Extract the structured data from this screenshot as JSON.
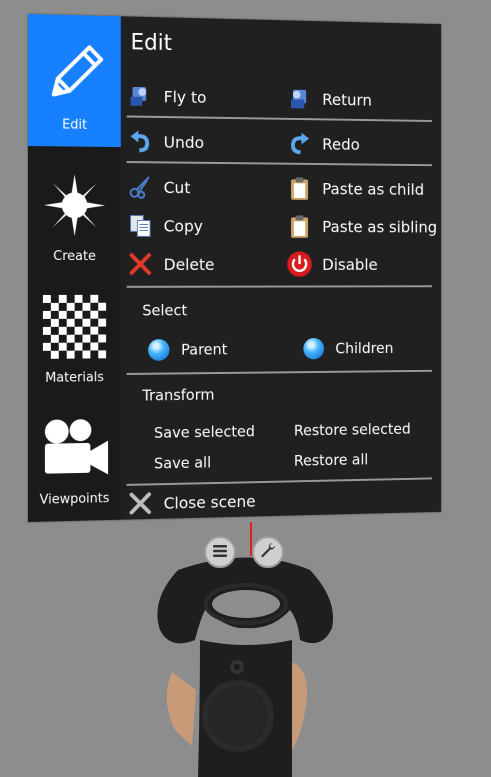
{
  "sidebar": {
    "items": [
      {
        "label": "Edit",
        "icon": "pencil-icon",
        "active": true
      },
      {
        "label": "Create",
        "icon": "sparkle-icon",
        "active": false
      },
      {
        "label": "Materials",
        "icon": "checkerboard-icon",
        "active": false
      },
      {
        "label": "Viewpoints",
        "icon": "movie-camera-icon",
        "active": false
      }
    ]
  },
  "main": {
    "title": "Edit",
    "fly_to": "Fly to",
    "return": "Return",
    "undo": "Undo",
    "redo": "Redo",
    "cut": "Cut",
    "paste_child": "Paste as child",
    "copy": "Copy",
    "paste_sibling": "Paste as sibling",
    "delete": "Delete",
    "disable": "Disable",
    "select_heading": "Select",
    "parent": "Parent",
    "children": "Children",
    "transform_heading": "Transform",
    "save_selected": "Save selected",
    "restore_selected": "Restore selected",
    "save_all": "Save all",
    "restore_all": "Restore all",
    "close_scene": "Close scene"
  },
  "controller": {
    "menu_icon": "menu-icon",
    "wrench_icon": "wrench-icon"
  },
  "colors": {
    "accent": "#1680ff",
    "panel_bg": "#202020",
    "sidebar_bg": "#1a1a1a",
    "background": "#8d8d8d",
    "disable_red": "#e02020"
  }
}
